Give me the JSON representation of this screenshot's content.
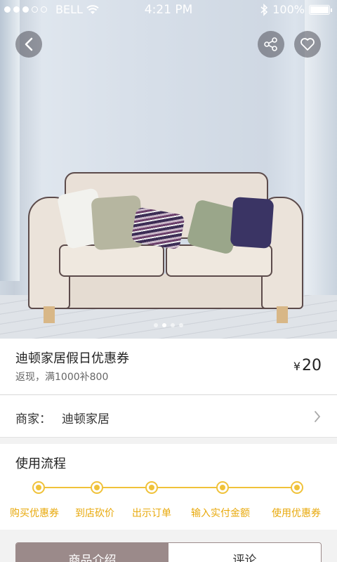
{
  "status_bar": {
    "carrier": "BELL",
    "time": "4:21 PM",
    "battery": "100%"
  },
  "hero": {
    "icons": [
      "back-icon",
      "share-icon",
      "heart-icon"
    ],
    "pager_count": 4,
    "pager_active_index": 1
  },
  "product": {
    "title": "迪顿家居假日优惠券",
    "subtitle": "返现，满1000补800",
    "currency": "¥",
    "price": "20"
  },
  "merchant": {
    "label": "商家：",
    "name": "迪顿家居"
  },
  "flow": {
    "title": "使用流程",
    "steps": [
      "购买优惠券",
      "到店砍价",
      "出示订单",
      "输入实付金额",
      "使用优惠券"
    ],
    "accent": "#f0c23a"
  },
  "tabs": {
    "items": [
      "商品介绍",
      "评论"
    ],
    "active_index": 0,
    "active_color": "#9b8a8a"
  }
}
